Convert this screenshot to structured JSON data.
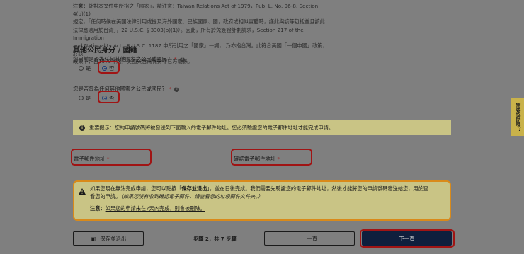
{
  "note": {
    "label": "注意：",
    "line1": "針對本文件中所指之「國家」，請注意：Taiwan Relations Act of 1979，Pub. L. No. 96-8, Section 4(b)(1)",
    "line2": "規定，「任何時候在美國法律引用或提及海外國家、民族國家、國，政府或相似實體時，謹此與該等包括並且該此",
    "line3": "法律應適用於台灣」，22 U.S.C. § 3303(b)(1)）。因此，所有於免簽證計劃請求，Section 217 of the Immigration",
    "line4": "and Nationality Act，8 U.S.C. 1187 中所引用之「國家」一詞， 乃亦指台灣。此符合美國「一個中國」政策，於該",
    "line5": "政策下，自1979年起，美國與台灣保持非官方關係。"
  },
  "section_title": "其他公民身分 / 國籍",
  "q1": {
    "label": "您目前是否為任何其他國家之公民或國民？",
    "required": "*",
    "help": "?",
    "yes": "是",
    "no": "否",
    "selected": "no"
  },
  "q2": {
    "label": "您是否曾為任何其他國家之公民或國民？",
    "required": "*",
    "help": "?",
    "yes": "是",
    "no": "否",
    "selected": "no"
  },
  "info": {
    "icon": "i",
    "text": "重要提示：您的申請號碼將被發送到下面輸入的電子郵件地址。您必須驗證您的電子郵件地址才能完成申請。"
  },
  "email_field": {
    "label": "電子郵件地址",
    "required": "*"
  },
  "confirm_email_field": {
    "label": "確認電子郵件地址",
    "required": "*"
  },
  "warning": {
    "icon": "⚠",
    "text1a": "如果您現在無法完成申請，您可以點按「",
    "text1b": "保存並退出",
    "text1c": "」，並在日後完成。我們需要先驗證您的電子郵件地址，然後才能將您的申請號碼發送給您，用於查",
    "text2": "看您的申請。",
    "text2i": "（如果您沒有收到確認電子郵件，請查看您的垃圾郵件文件夾。）",
    "note_label": "注意：",
    "note_text": "如果您的申請未在7天內完成，則會被刪除。"
  },
  "buttons": {
    "save": "保存並退出",
    "save_icon": "▣",
    "prev": "上一頁",
    "next": "下一頁"
  },
  "step": "步驟 2，共 7 步驟",
  "help_tab": "需要協助嗎？",
  "colors": {
    "overlay": "#7f7f7f",
    "highlight": "#a01414",
    "primary": "#0f1f3d",
    "info_bg": "#c9c485",
    "warn_border": "#d98a1a"
  }
}
